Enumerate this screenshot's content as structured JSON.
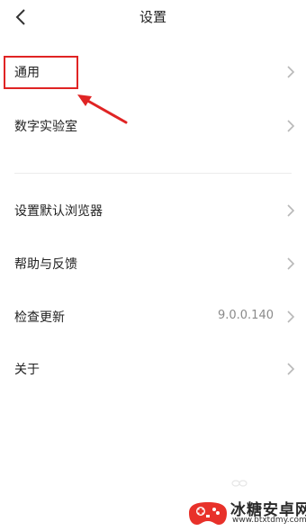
{
  "header": {
    "title": "设置",
    "back_icon": "chevron-left-icon"
  },
  "items": [
    {
      "label": "通用",
      "value": "",
      "icon": "chevron-right-icon"
    },
    {
      "label": "数字实验室",
      "value": "",
      "icon": "chevron-right-icon"
    },
    {
      "label": "设置默认浏览器",
      "value": "",
      "icon": "chevron-right-icon"
    },
    {
      "label": "帮助与反馈",
      "value": "",
      "icon": "chevron-right-icon"
    },
    {
      "label": "检查更新",
      "value": "9.0.0.140",
      "icon": "chevron-right-icon"
    },
    {
      "label": "关于",
      "value": "",
      "icon": "chevron-right-icon"
    }
  ],
  "annotation": {
    "highlight_color": "#e02424",
    "target": "通用"
  },
  "watermark": {
    "name": "冰糖安卓网",
    "url": "www.btxtdmy.com",
    "colors": {
      "red": "#e8312a",
      "dark": "#2a2a2a"
    }
  }
}
